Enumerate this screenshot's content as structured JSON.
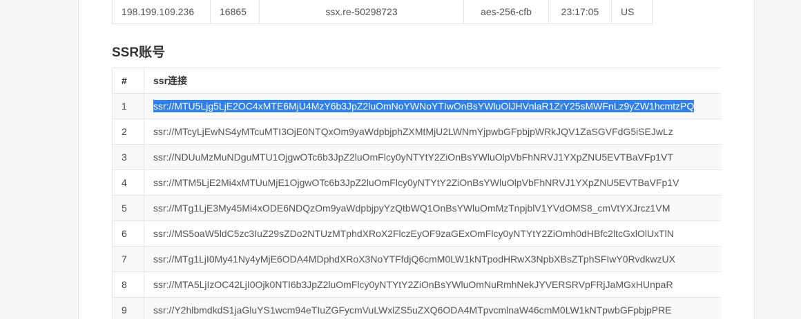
{
  "top_row": {
    "ip": "198.199.109.236",
    "port": "16865",
    "password": "ssx.re-50298723",
    "method": "aes-256-cfb",
    "time": "23:17:05",
    "country": "US"
  },
  "section_title": "SSR账号",
  "ssr_table": {
    "headers": [
      "#",
      "ssr连接"
    ],
    "rows": [
      {
        "num": "1",
        "link": "ssr://MTU5Ljg5LjE2OC4xMTE6MjU4MzY6b3JpZ2luOmNoYWNoYTIwOnBsYWluOlJHVnlaR1ZrY25sMWFnLz9yZW1hcmtzPQ"
      },
      {
        "num": "2",
        "link": "ssr://MTcyLjEwNS4yMTcuMTI3OjE0NTQxOm9yaWdpbjphZXMtMjU2LWNmYjpwbGFpbjpWRkJQV1ZaSGVFdG5iSEJwLz"
      },
      {
        "num": "3",
        "link": "ssr://NDUuMzMuNDguMTU1OjgwOTc6b3JpZ2luOmFlcy0yNTYtY2ZiOnBsYWluOlpVbFhNRVJ1YXpZNU5EVTBaVFp1VT"
      },
      {
        "num": "4",
        "link": "ssr://MTM5LjE2Mi4xMTUuMjE1OjgwOTc6b3JpZ2luOmFlcy0yNTYtY2ZiOnBsYWluOlpVbFhNRVJ1YXpZNU5EVTBaVFp1V"
      },
      {
        "num": "5",
        "link": "ssr://MTg1LjE3My45Mi4xODE6NDQzOm9yaWdpbjpyYzQtbWQ1OnBsYWluOmMzTnpjblV1YVdOMS8_cmVtYXJrcz1VM"
      },
      {
        "num": "6",
        "link": "ssr://MS5oaW5ldC5zc3IuZ29sZDo2NTUzMTphdXRoX2FlczEyOF9zaGExOmFlcy0yNTYtY2ZiOmh0dHBfc2ltcGxlOlUxTlN"
      },
      {
        "num": "7",
        "link": "ssr://MTg1LjI0My41Ny4yMjE6ODA4MDphdXRoX3NoYTFfdjQ6cmM0LW1kNTpodHRwX3NpbXBsZTphSFIwY0RvdkwzUX"
      },
      {
        "num": "8",
        "link": "ssr://MTA5LjIzOC42LjI0Ojk0NTI6b3JpZ2luOmFlcy0yNTYtY2ZiOnBsYWluOmNuRmhNekJYVERSRVpFRjJaMGxHUnpaR"
      },
      {
        "num": "9",
        "link": "ssr://Y2hlbmdkdS1jaGluYS1wcm94eTIuZGFycmVuLWxlZS5uZXQ6ODA4MTpvcmlnaW46cmM0LW1kNTpwbGFpbjpPRE"
      }
    ]
  }
}
